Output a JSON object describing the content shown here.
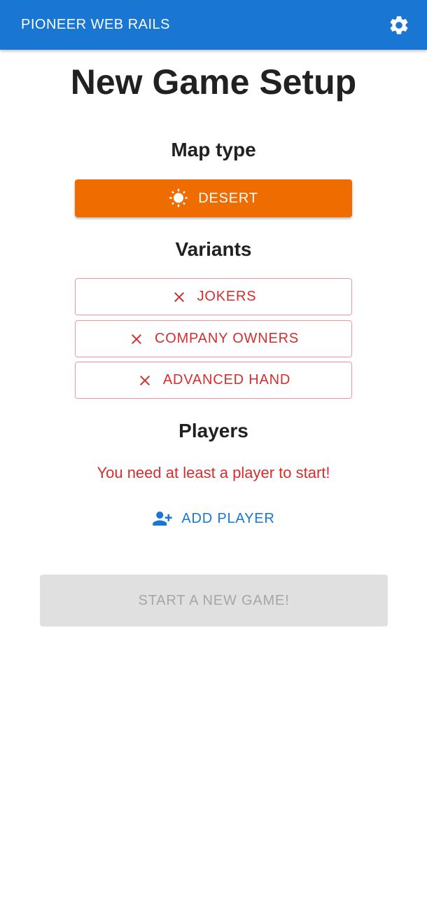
{
  "appbar": {
    "title": "PIONEER WEB RAILS",
    "settings_icon": "gear-icon"
  },
  "page": {
    "title": "New Game Setup"
  },
  "map_type": {
    "heading": "Map type",
    "selected_label": "DESERT",
    "icon": "sun-icon",
    "color": "#ef6c00"
  },
  "variants": {
    "heading": "Variants",
    "items": [
      {
        "label": "JOKERS",
        "icon": "close-icon"
      },
      {
        "label": "COMPANY OWNERS",
        "icon": "close-icon"
      },
      {
        "label": "ADVANCED HAND",
        "icon": "close-icon"
      }
    ],
    "color": "#d32f2f"
  },
  "players": {
    "heading": "Players",
    "error_message": "You need at least a player to start!",
    "add_label": "ADD PLAYER",
    "add_icon": "add-person-icon"
  },
  "start": {
    "label": "START A NEW GAME!",
    "disabled": true
  },
  "colors": {
    "primary": "#1976d2",
    "error": "#d32f2f",
    "disabled_bg": "#e0e0e0",
    "disabled_text": "#a6a6a6"
  }
}
